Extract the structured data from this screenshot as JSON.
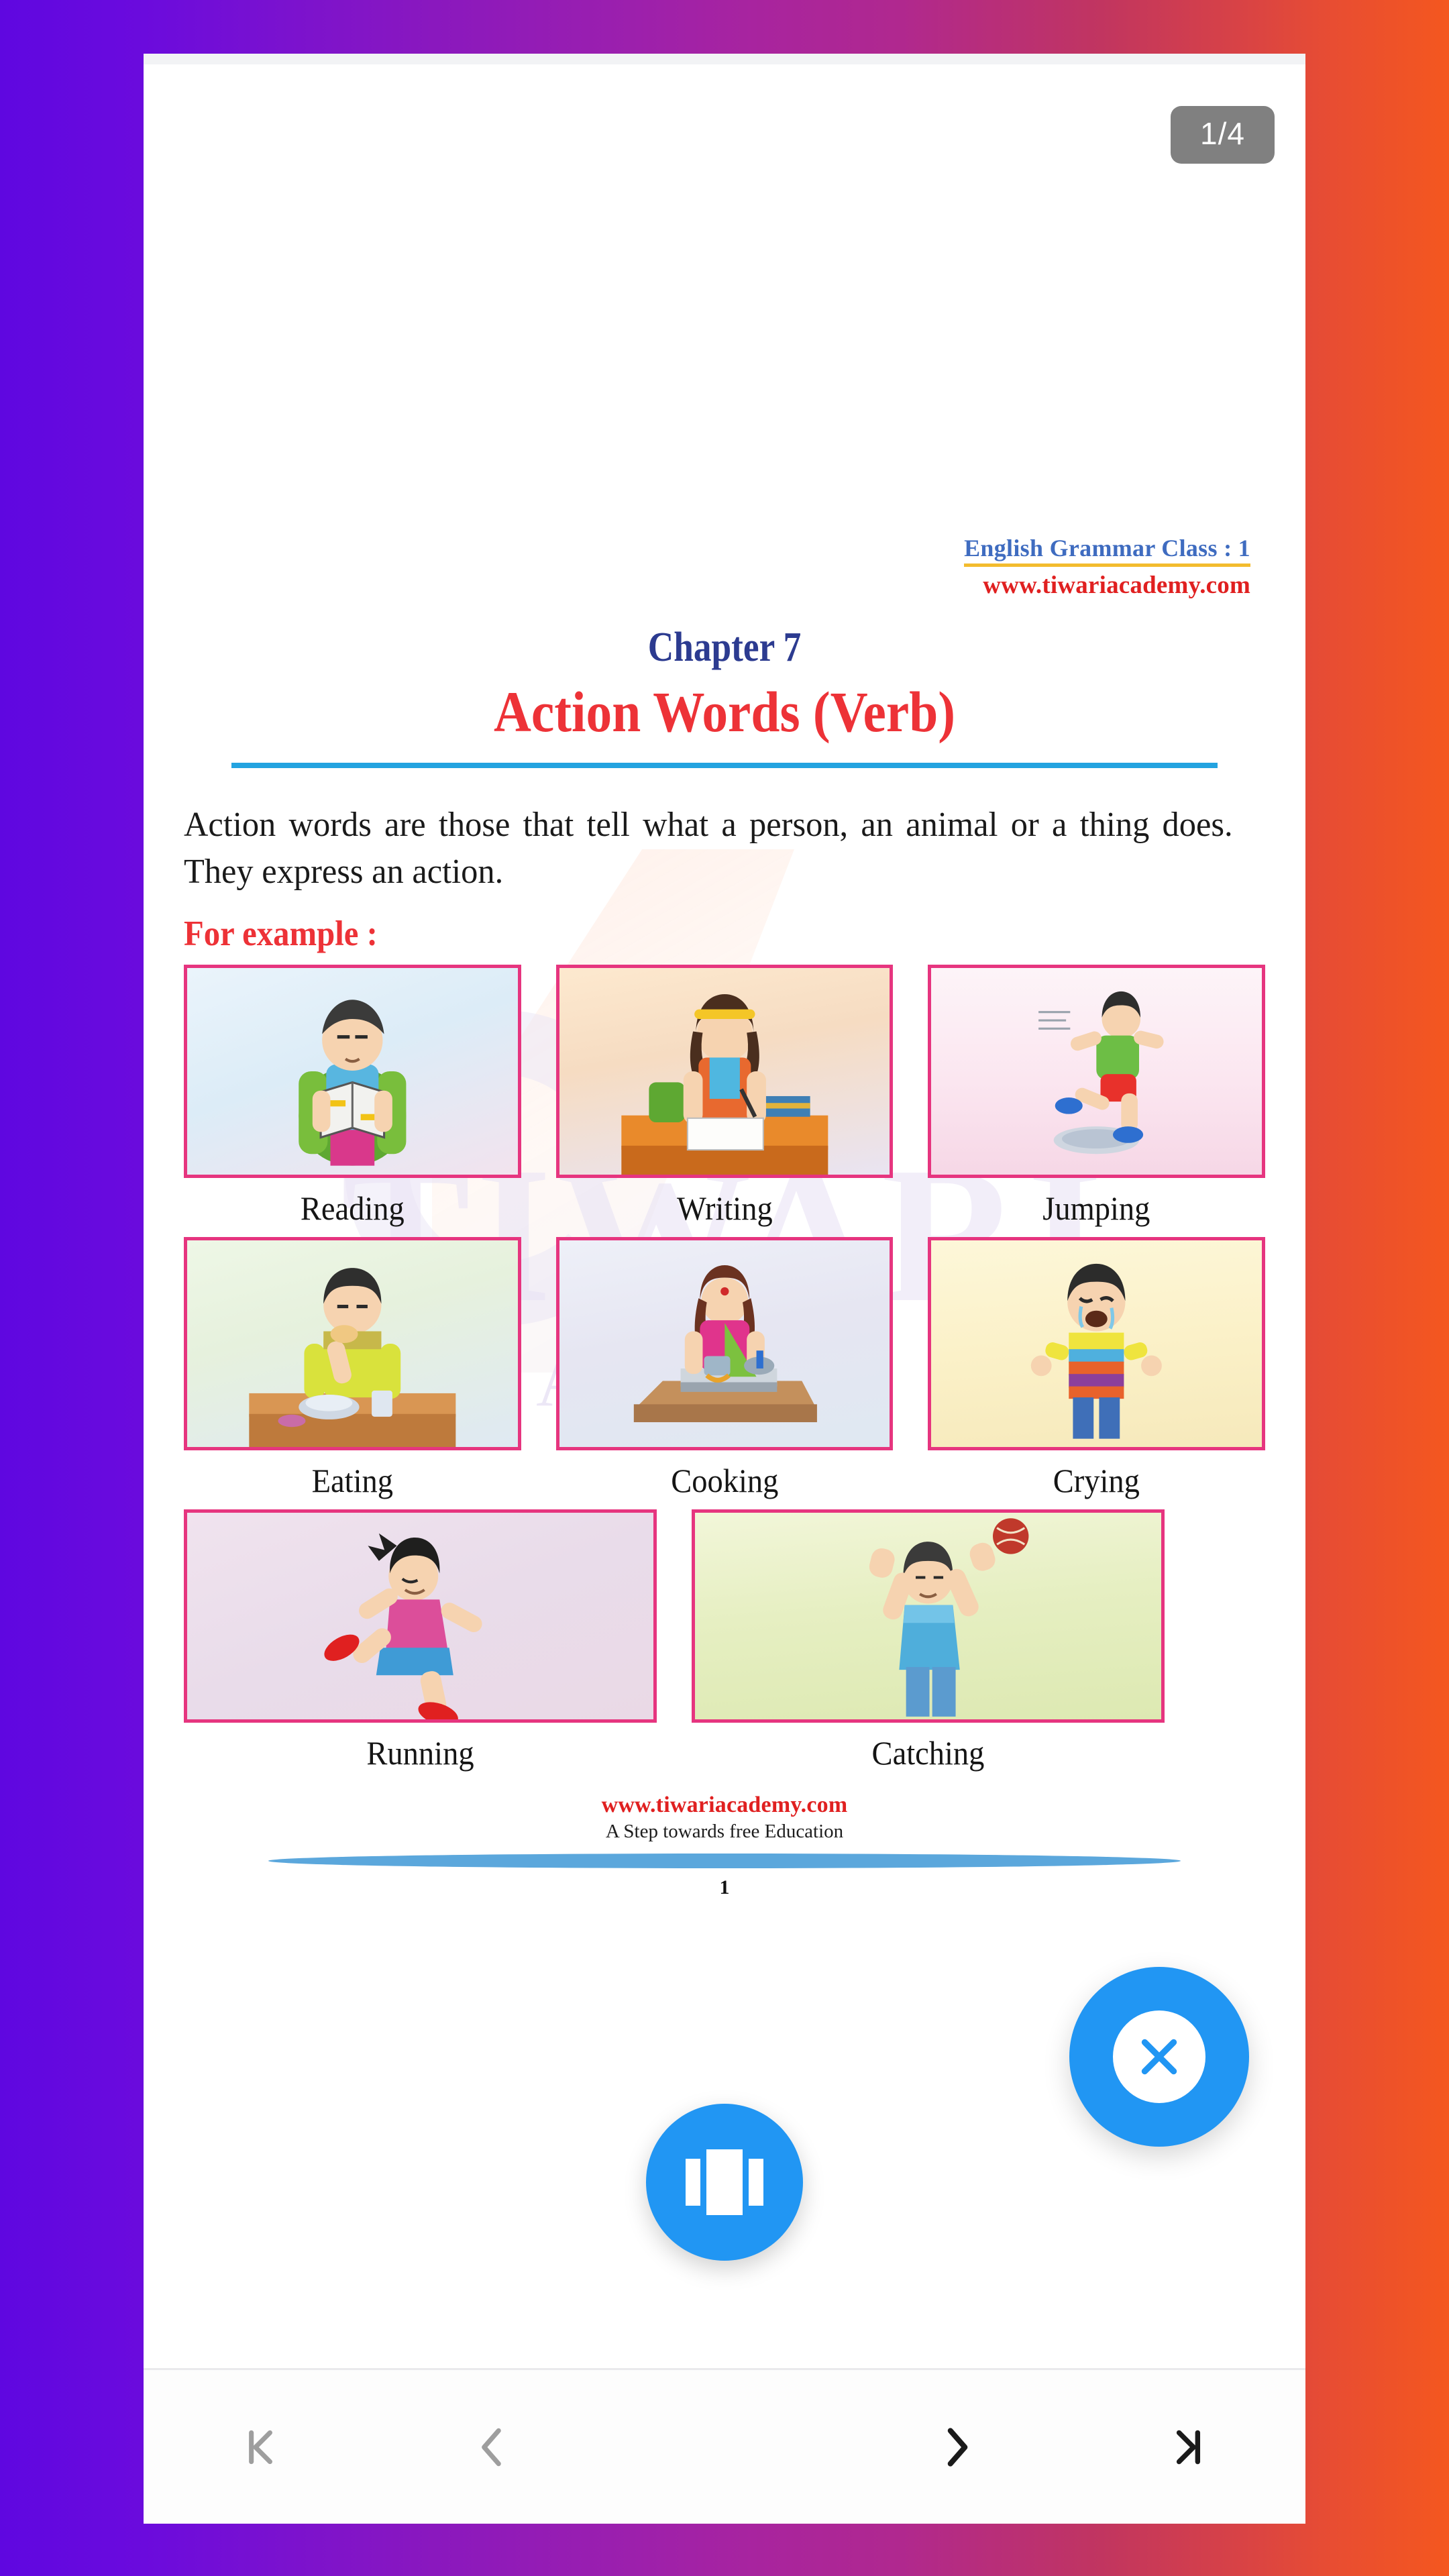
{
  "app": {
    "background_gradient_start": "#5F07E0",
    "background_gradient_end": "#F4571F",
    "accent_blue": "#2196F3"
  },
  "viewer": {
    "page_badge": "1/4"
  },
  "document": {
    "watermark": {
      "brand_primary": "TIWARI",
      "brand_secondary": "A C A D E M Y"
    },
    "header": {
      "course_line": "English Grammar Class : 1",
      "website": "www.tiwariacademy.com",
      "course_color": "#3F6CC0",
      "website_color": "#E02020",
      "underline_color": "#F3BC2E"
    },
    "title": {
      "chapter_number": "Chapter 7",
      "chapter_name": "Action Words (Verb)",
      "chapter_number_color": "#2C3B90",
      "chapter_name_color": "#ED3237",
      "rule_color": "#23A3E0"
    },
    "body": {
      "paragraph": "Action words are those that tell what a person, an animal or a thing does. They express an action.",
      "example_label": "For example :"
    },
    "examples": {
      "border_color": "#E6357F",
      "rows": [
        [
          {
            "caption": "Reading",
            "illustration": "boy-reading-book"
          },
          {
            "caption": "Writing",
            "illustration": "girl-writing-at-desk"
          },
          {
            "caption": "Jumping",
            "illustration": "boy-jumping-over-puddle"
          }
        ],
        [
          {
            "caption": "Eating",
            "illustration": "boy-eating-at-table"
          },
          {
            "caption": "Cooking",
            "illustration": "woman-cooking-on-stove"
          },
          {
            "caption": "Crying",
            "illustration": "boy-crying"
          }
        ],
        [
          {
            "caption": "Running",
            "illustration": "boy-running"
          },
          {
            "caption": "Catching",
            "illustration": "boy-catching-ball"
          }
        ]
      ]
    },
    "footer": {
      "website": "www.tiwariacademy.com",
      "tagline": "A Step towards free Education",
      "page_number": "1",
      "website_color": "#E02020",
      "divider_color": "#5BA7DC"
    }
  },
  "controls": {
    "close_button": "close-icon",
    "view_mode_button": "carousel-view-icon",
    "nav": [
      {
        "name": "first-page",
        "icon": "first-page-icon",
        "enabled": false
      },
      {
        "name": "previous-page",
        "icon": "chevron-left-icon",
        "enabled": false
      },
      {
        "name": "next-page",
        "icon": "chevron-right-icon",
        "enabled": true
      },
      {
        "name": "last-page",
        "icon": "last-page-icon",
        "enabled": true
      }
    ]
  }
}
